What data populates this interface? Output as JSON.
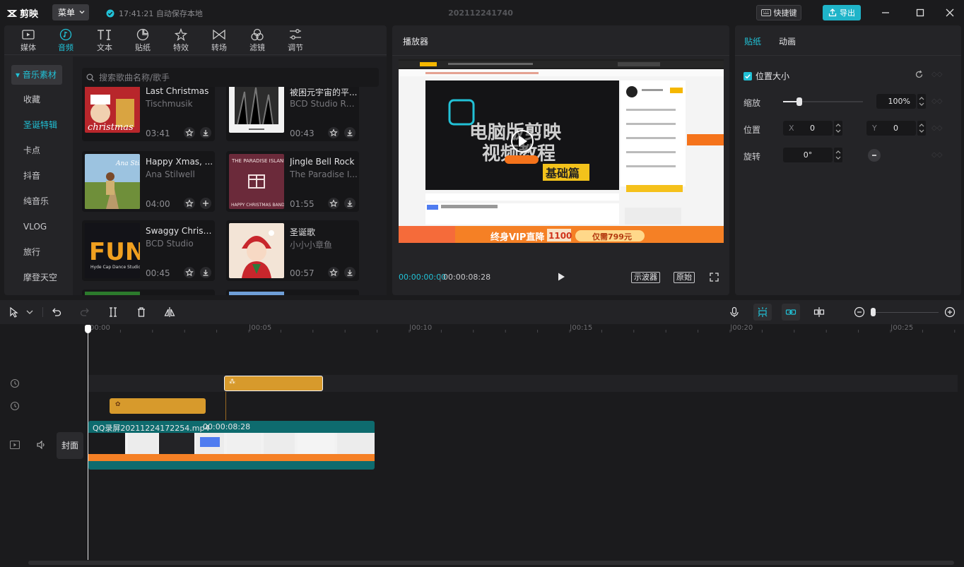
{
  "app": {
    "name": "剪映",
    "menu_label": "菜单",
    "save_status": "17:41:21 自动保存本地",
    "project_title": "202112241740",
    "shortcut_label": "快捷键",
    "export_label": "导出"
  },
  "toolbar": {
    "tabs": [
      {
        "label": "媒体",
        "icon": "media-icon"
      },
      {
        "label": "音频",
        "icon": "audio-icon"
      },
      {
        "label": "文本",
        "icon": "text-icon"
      },
      {
        "label": "贴纸",
        "icon": "sticker-icon"
      },
      {
        "label": "特效",
        "icon": "effects-icon"
      },
      {
        "label": "转场",
        "icon": "transition-icon"
      },
      {
        "label": "滤镜",
        "icon": "filter-icon"
      },
      {
        "label": "调节",
        "icon": "adjust-icon"
      }
    ],
    "active": "音频"
  },
  "sidebar": {
    "category": "▾ 音乐素材",
    "items": [
      {
        "label": "收藏"
      },
      {
        "label": "圣诞特辑"
      },
      {
        "label": "卡点"
      },
      {
        "label": "抖音"
      },
      {
        "label": "纯音乐"
      },
      {
        "label": "VLOG"
      },
      {
        "label": "旅行"
      },
      {
        "label": "摩登天空"
      }
    ],
    "selected": "圣诞特辑"
  },
  "search": {
    "placeholder": "搜索歌曲名称/歌手"
  },
  "music": [
    {
      "title": "Last Christmas",
      "artist": "Tischmusik",
      "duration": "03:41",
      "thumb_color": "#b8262b",
      "action": "download"
    },
    {
      "title": "被困元宇宙的平...",
      "artist": "BCD Studio Ra...",
      "duration": "00:43",
      "thumb_color": "#e8e8e8",
      "action": "download"
    },
    {
      "title": "Happy Xmas, ...",
      "artist": "Ana Stilwell",
      "duration": "04:00",
      "thumb_color": "#6f8f3a",
      "action": "add"
    },
    {
      "title": "Jingle Bell Rock",
      "artist": "The Paradise I...",
      "duration": "01:55",
      "thumb_color": "#6b2a3a",
      "action": "download"
    },
    {
      "title": "Swaggy Christ...",
      "artist": "BCD Studio",
      "duration": "00:45",
      "thumb_color": "#131318",
      "action": "download"
    },
    {
      "title": "圣诞歌",
      "artist": "小小小章鱼",
      "duration": "00:57",
      "thumb_color": "#3c0f12",
      "action": "download"
    }
  ],
  "player": {
    "title": "播放器",
    "current_time": "00:00:00:00",
    "total_time": "00:00:08:28",
    "waveform_label": "示波器",
    "original_label": "原始",
    "preview": {
      "headline1": "电脑版剪映",
      "headline2": "视频教程",
      "subtitle": "基础篇",
      "banner_vip": "终身VIP直降",
      "banner_price": "1100",
      "banner_now": "仅需799元"
    }
  },
  "properties": {
    "tab_sticker": "贴纸",
    "tab_animation": "动画",
    "section": "位置大小",
    "scale_label": "缩放",
    "scale_value": "100%",
    "scale_fraction": 0.2,
    "position_label": "位置",
    "x_label": "X",
    "x_value": "0",
    "y_label": "Y",
    "y_value": "0",
    "rotate_label": "旋转",
    "rotate_value": "0°"
  },
  "timeline": {
    "ticks": [
      "00:00",
      "|00:05",
      "|00:10",
      "|00:15",
      "|00:20",
      "|00:25"
    ],
    "video_clip_name": "QQ录屏20211224172254.mp4",
    "video_clip_duration": "00:00:08:28",
    "cover_label": "封面"
  }
}
